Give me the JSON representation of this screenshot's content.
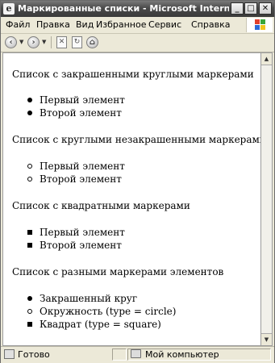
{
  "window": {
    "title": "Маркированные списки - Microsoft Internet Explorer",
    "buttons": {
      "minimize": "_",
      "maximize": "□",
      "close": "✕"
    }
  },
  "menu": {
    "items": [
      "Файл",
      "Правка",
      "Вид",
      "Избранное",
      "Сервис",
      "Справка"
    ],
    "logo_colors": [
      "#e2402b",
      "#3aa639",
      "#2d6ad6",
      "#f2c41c"
    ]
  },
  "toolbar": {
    "items": [
      "back-icon",
      "forward-icon",
      "stop-icon",
      "refresh-icon",
      "home-icon"
    ]
  },
  "document": {
    "lists": [
      {
        "heading": "Список с закрашенными круглыми маркерами",
        "items": [
          {
            "text": "Первый элемент",
            "marker": "disc"
          },
          {
            "text": "Второй элемент",
            "marker": "disc"
          }
        ]
      },
      {
        "heading": "Список с круглыми незакрашенными маркерами",
        "items": [
          {
            "text": "Первый элемент",
            "marker": "circle"
          },
          {
            "text": "Второй элемент",
            "marker": "circle"
          }
        ]
      },
      {
        "heading": "Список с квадратными маркерами",
        "items": [
          {
            "text": "Первый элемент",
            "marker": "square"
          },
          {
            "text": "Второй элемент",
            "marker": "square"
          }
        ]
      },
      {
        "heading": "Список с разными маркерами элементов",
        "items": [
          {
            "text": "Закрашенный круг",
            "marker": "disc"
          },
          {
            "text": "Окружность (type = circle)",
            "marker": "circle"
          },
          {
            "text": "Квадрат (type = square)",
            "marker": "square"
          }
        ]
      }
    ]
  },
  "scrollbar": {
    "up": "▲",
    "down": "▼"
  },
  "status": {
    "left_text": "Готово",
    "zone_text": "Мой компьютер"
  }
}
